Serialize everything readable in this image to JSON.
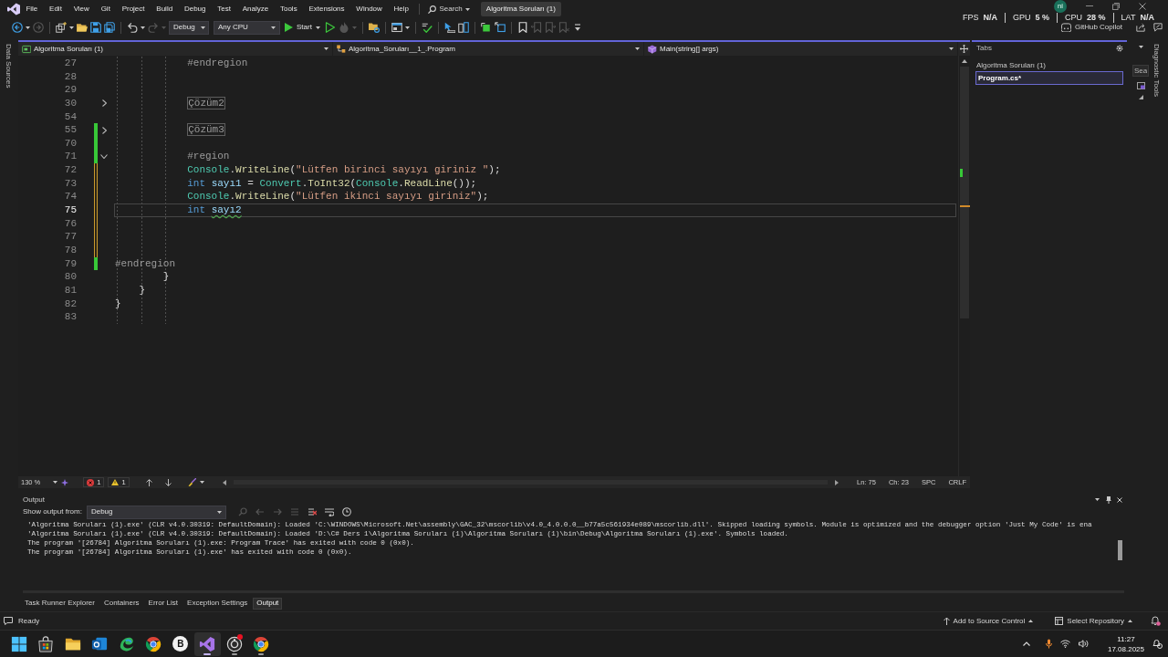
{
  "title_bar": {
    "menu": [
      "File",
      "Edit",
      "View",
      "Git",
      "Project",
      "Build",
      "Debug",
      "Test",
      "Analyze",
      "Tools",
      "Extensions",
      "Window",
      "Help"
    ],
    "search": "Search",
    "solution": "Algoritma Soruları (1)"
  },
  "account": {
    "initials": "ni"
  },
  "performance_overlay": [
    {
      "label": "FPS",
      "value": "N/A"
    },
    {
      "label": "GPU",
      "value": "5 %"
    },
    {
      "label": "CPU",
      "value": "28 %"
    },
    {
      "label": "LAT",
      "value": "N/A"
    }
  ],
  "toolbar": {
    "items": [
      {
        "kind": "back",
        "disabled": false
      },
      {
        "kind": "forward",
        "disabled": true
      },
      {
        "kind": "separator"
      },
      {
        "kind": "new-item",
        "disabled": false
      },
      {
        "kind": "open",
        "disabled": false
      },
      {
        "kind": "save",
        "disabled": false
      },
      {
        "kind": "save-all",
        "disabled": false
      },
      {
        "kind": "separator"
      },
      {
        "kind": "undo",
        "disabled": false
      },
      {
        "kind": "redo",
        "disabled": true
      },
      {
        "kind": "configuration",
        "value": "Debug",
        "disabled": false
      },
      {
        "kind": "platform",
        "value": "Any CPU",
        "disabled": false
      },
      {
        "kind": "start",
        "label": "Start",
        "disabled": false
      },
      {
        "kind": "run",
        "disabled": false
      },
      {
        "kind": "hot-reload",
        "disabled": true
      },
      {
        "kind": "separator"
      },
      {
        "kind": "folder-settings",
        "disabled": false
      },
      {
        "kind": "separator"
      },
      {
        "kind": "layout",
        "disabled": false
      },
      {
        "kind": "separator"
      },
      {
        "kind": "spell-check",
        "disabled": false
      },
      {
        "kind": "separator"
      },
      {
        "kind": "pointer",
        "disabled": false
      },
      {
        "kind": "panels",
        "disabled": false
      },
      {
        "kind": "separator"
      },
      {
        "kind": "square-arrow",
        "disabled": false
      },
      {
        "kind": "square-arrows",
        "disabled": false
      },
      {
        "kind": "separator"
      },
      {
        "kind": "bookmark",
        "disabled": false
      },
      {
        "kind": "bookmark-prev",
        "disabled": true
      },
      {
        "kind": "bookmark-next",
        "disabled": true
      },
      {
        "kind": "bookmark-clear",
        "disabled": true
      },
      {
        "kind": "overflow",
        "disabled": false
      }
    ],
    "copilot": "GitHub Copilot"
  },
  "left_strip": {
    "tabs": [
      "Data Sources"
    ]
  },
  "editor": {
    "navigation": [
      "Algoritma Soruları (1)",
      "Algoritma_Soruları__1_.Program",
      "Main(string[] args)"
    ],
    "lines": [
      {
        "number": "27",
        "current": false,
        "saved_change": false,
        "unsaved_change": false,
        "collapsed": false,
        "expanded": false,
        "tokens": [
          {
            "kind": "preprocessor",
            "text": "            #endregion"
          }
        ]
      },
      {
        "number": "28",
        "current": false,
        "saved_change": false,
        "unsaved_change": false,
        "collapsed": false,
        "expanded": false
      },
      {
        "number": "29",
        "current": false,
        "saved_change": false,
        "unsaved_change": false,
        "collapsed": false,
        "expanded": false
      },
      {
        "number": "30",
        "current": false,
        "saved_change": false,
        "unsaved_change": false,
        "collapsed": true,
        "expanded": false,
        "tokens": [
          {
            "kind": "collapsed",
            "text": "            Çözüm2"
          }
        ]
      },
      {
        "number": "54",
        "current": false,
        "saved_change": false,
        "unsaved_change": false,
        "collapsed": false,
        "expanded": false
      },
      {
        "number": "55",
        "current": false,
        "saved_change": true,
        "unsaved_change": false,
        "collapsed": true,
        "expanded": false,
        "tokens": [
          {
            "kind": "collapsed",
            "text": "            Çözüm3"
          }
        ]
      },
      {
        "number": "70",
        "current": false,
        "saved_change": true,
        "unsaved_change": false,
        "collapsed": false,
        "expanded": false
      },
      {
        "number": "71",
        "current": false,
        "saved_change": true,
        "unsaved_change": false,
        "collapsed": false,
        "expanded": true,
        "tokens": [
          {
            "kind": "preprocessor",
            "text": "            #region"
          }
        ]
      },
      {
        "number": "72",
        "current": false,
        "saved_change": false,
        "unsaved_change": true,
        "collapsed": false,
        "expanded": false,
        "tokens": [
          {
            "kind": "type",
            "text": "            Console"
          },
          {
            "kind": "punctuation",
            "text": "."
          },
          {
            "kind": "method",
            "text": "WriteLine"
          },
          {
            "kind": "punctuation",
            "text": "("
          },
          {
            "kind": "string",
            "text": "\"Lütfen birinci sayıyı giriniz \""
          },
          {
            "kind": "punctuation",
            "text": ");"
          }
        ]
      },
      {
        "number": "73",
        "current": false,
        "saved_change": false,
        "unsaved_change": true,
        "collapsed": false,
        "expanded": false,
        "tokens": [
          {
            "kind": "keyword",
            "text": "            int "
          },
          {
            "kind": "variable",
            "text": "sayı1"
          },
          {
            "kind": "punctuation",
            "text": " = "
          },
          {
            "kind": "type",
            "text": "Convert"
          },
          {
            "kind": "punctuation",
            "text": "."
          },
          {
            "kind": "method",
            "text": "ToInt32"
          },
          {
            "kind": "punctuation",
            "text": "("
          },
          {
            "kind": "type",
            "text": "Console"
          },
          {
            "kind": "punctuation",
            "text": "."
          },
          {
            "kind": "method",
            "text": "ReadLine"
          },
          {
            "kind": "punctuation",
            "text": "());"
          }
        ]
      },
      {
        "number": "74",
        "current": false,
        "saved_change": false,
        "unsaved_change": true,
        "collapsed": false,
        "expanded": false,
        "tokens": [
          {
            "kind": "type",
            "text": "            Console"
          },
          {
            "kind": "punctuation",
            "text": "."
          },
          {
            "kind": "method",
            "text": "WriteLine"
          },
          {
            "kind": "punctuation",
            "text": "("
          },
          {
            "kind": "string",
            "text": "\"Lütfen ikinci sayıyı giriniz\""
          },
          {
            "kind": "punctuation",
            "text": ");"
          }
        ]
      },
      {
        "number": "75",
        "current": true,
        "saved_change": false,
        "unsaved_change": true,
        "collapsed": false,
        "expanded": false,
        "tokens": [
          {
            "kind": "keyword",
            "text": "            int "
          },
          {
            "kind": "variable-warning",
            "text": "sayı2"
          }
        ]
      },
      {
        "number": "76",
        "current": false,
        "saved_change": false,
        "unsaved_change": true,
        "collapsed": false,
        "expanded": false
      },
      {
        "number": "77",
        "current": false,
        "saved_change": false,
        "unsaved_change": true,
        "collapsed": false,
        "expanded": false
      },
      {
        "number": "78",
        "current": false,
        "saved_change": false,
        "unsaved_change": true,
        "collapsed": false,
        "expanded": false
      },
      {
        "number": "79",
        "current": false,
        "saved_change": true,
        "unsaved_change": false,
        "collapsed": false,
        "expanded": false,
        "tokens": [
          {
            "kind": "preprocessor",
            "text": "#endregion"
          }
        ]
      },
      {
        "number": "80",
        "current": false,
        "saved_change": false,
        "unsaved_change": false,
        "collapsed": false,
        "expanded": false,
        "tokens": [
          {
            "kind": "punctuation",
            "text": "        }"
          }
        ]
      },
      {
        "number": "81",
        "current": false,
        "saved_change": false,
        "unsaved_change": false,
        "collapsed": false,
        "expanded": false,
        "tokens": [
          {
            "kind": "punctuation",
            "text": "    }"
          }
        ]
      },
      {
        "number": "82",
        "current": false,
        "saved_change": false,
        "unsaved_change": false,
        "collapsed": false,
        "expanded": false,
        "tokens": [
          {
            "kind": "punctuation",
            "text": "}"
          }
        ]
      },
      {
        "number": "83",
        "current": false,
        "saved_change": false,
        "unsaved_change": false,
        "collapsed": false,
        "expanded": false
      }
    ],
    "status": {
      "zoom": "130 %",
      "errors": "1",
      "warnings": "1",
      "line": "Ln: 75",
      "column": "Ch: 23",
      "indent": "SPC",
      "line_ending": "CRLF"
    }
  },
  "tabs_window": {
    "title": "Tabs",
    "group": "Algoritma Soruları (1)",
    "items": [
      {
        "label": "Program.cs*",
        "selected": true
      }
    ]
  },
  "right_strip": {
    "placeholder": "Sea",
    "tabs": [
      "Diagnostic Tools"
    ]
  },
  "output": {
    "title": "Output",
    "source_label": "Show output from:",
    "source": "Debug",
    "lines": [
      "'Algoritma Soruları (1).exe' (CLR v4.0.30319: DefaultDomain): Loaded 'C:\\WINDOWS\\Microsoft.Net\\assembly\\GAC_32\\mscorlib\\v4.0_4.0.0.0__b77a5c561934e089\\mscorlib.dll'. Skipped loading symbols. Module is optimized and the debugger option 'Just My Code' is ena",
      "'Algoritma Soruları (1).exe' (CLR v4.0.30319: DefaultDomain): Loaded 'D:\\C# Ders 1\\Algoritma Soruları (1)\\Algoritma Soruları (1)\\bin\\Debug\\Algoritma Soruları (1).exe'. Symbols loaded.",
      "The program '[26784] Algoritma Soruları (1).exe: Program Trace' has exited with code 0 (0x0).",
      "The program '[26784] Algoritma Soruları (1).exe' has exited with code 0 (0x0)."
    ]
  },
  "bottom_tabs": [
    {
      "label": "Task Runner Explorer",
      "selected": false
    },
    {
      "label": "Containers",
      "selected": false
    },
    {
      "label": "Error List",
      "selected": false
    },
    {
      "label": "Exception Settings",
      "selected": false
    },
    {
      "label": "Output",
      "selected": true
    }
  ],
  "status_bar": {
    "text": "Ready",
    "source_control": "Add to Source Control",
    "repository": "Select Repository"
  },
  "taskbar": {
    "apps": [
      {
        "kind": "start",
        "selected": false,
        "running": false,
        "badge": false
      },
      {
        "kind": "store",
        "selected": false,
        "running": false,
        "badge": false
      },
      {
        "kind": "folder",
        "selected": false,
        "running": false,
        "badge": false
      },
      {
        "kind": "mail",
        "selected": false,
        "running": false,
        "badge": false
      },
      {
        "kind": "swirl",
        "selected": false,
        "running": false,
        "badge": false
      },
      {
        "kind": "browser",
        "selected": false,
        "running": false,
        "badge": false
      },
      {
        "kind": "letter",
        "label": "B",
        "selected": false,
        "running": false,
        "badge": false
      },
      {
        "kind": "ide",
        "selected": true,
        "running": true,
        "badge": false
      },
      {
        "kind": "recorder",
        "selected": false,
        "running": true,
        "badge": true
      },
      {
        "kind": "browser",
        "selected": false,
        "running": true,
        "badge": false
      }
    ],
    "time": "11:27",
    "date": "17.08.2025"
  }
}
